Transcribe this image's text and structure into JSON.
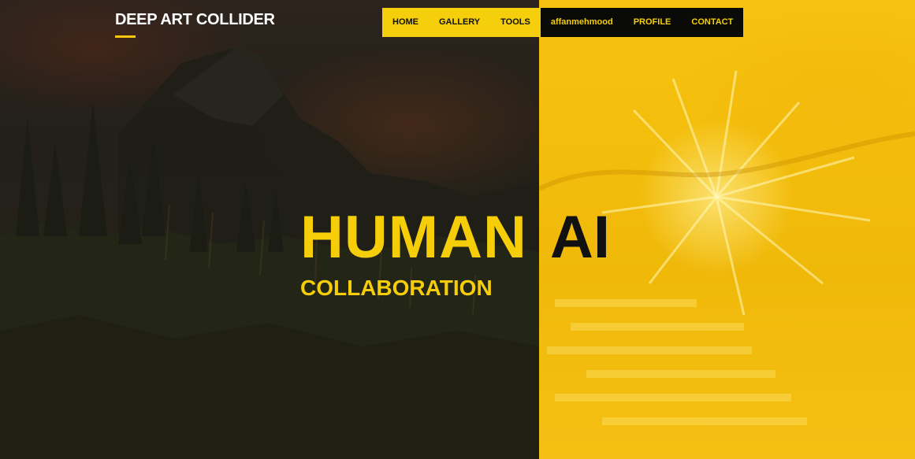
{
  "header": {
    "brand": "DEEP ART COLLIDER"
  },
  "nav": {
    "items": [
      {
        "label": "HOME"
      },
      {
        "label": "GALLERY"
      },
      {
        "label": "TOOLS"
      },
      {
        "label": "affanmehmood"
      },
      {
        "label": "PROFILE"
      },
      {
        "label": "CONTACT"
      }
    ]
  },
  "hero": {
    "word_human": "HUMAN",
    "word_ai": "AI",
    "subtitle": "COLLABORATION"
  },
  "colors": {
    "accent_yellow": "#f5cd08",
    "nav_black": "#0a0a08",
    "text_dark": "#111111"
  }
}
